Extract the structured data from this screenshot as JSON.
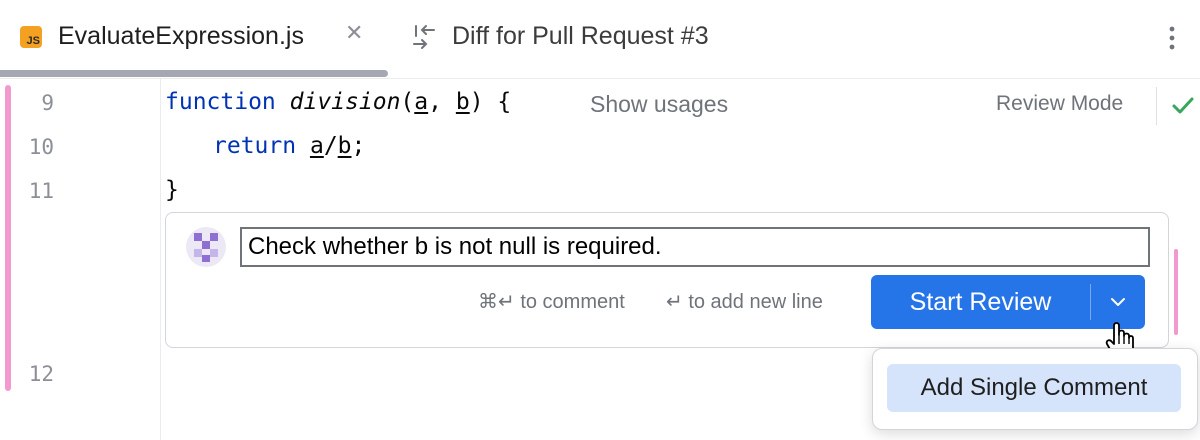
{
  "tabs": [
    {
      "icon": "javascript-file-icon",
      "badge_text": "JS",
      "label": "EvaluateExpression.js",
      "active": true
    },
    {
      "icon": "diff-icon",
      "label": "Diff for Pull Request #3",
      "active": false
    }
  ],
  "editor": {
    "line_numbers": [
      "9",
      "10",
      "11",
      "12"
    ],
    "code": {
      "line9": {
        "keyword": "function",
        "name": "division",
        "open": "(",
        "param_a": "a",
        "comma": ", ",
        "param_b": "b",
        "close": ") {"
      },
      "line10": {
        "keyword": "return",
        "a": "a",
        "slash": "/",
        "b": "b",
        "end": ";"
      },
      "line11": "}"
    },
    "inlay_hint": "Show usages",
    "review_mode_label": "Review Mode"
  },
  "comment": {
    "text": "Check whether b is not null is required.",
    "hint_submit": "⌘↵ to comment",
    "hint_newline": "↵ to add new line",
    "primary_button": "Start Review"
  },
  "popup": {
    "items": [
      "Add Single Comment"
    ]
  },
  "colors": {
    "accent": "#2675e8",
    "change_marker": "#f29ad0",
    "keyword": "#0033b3",
    "check": "#3aa55d",
    "popup_selection": "#d5e3fb"
  }
}
